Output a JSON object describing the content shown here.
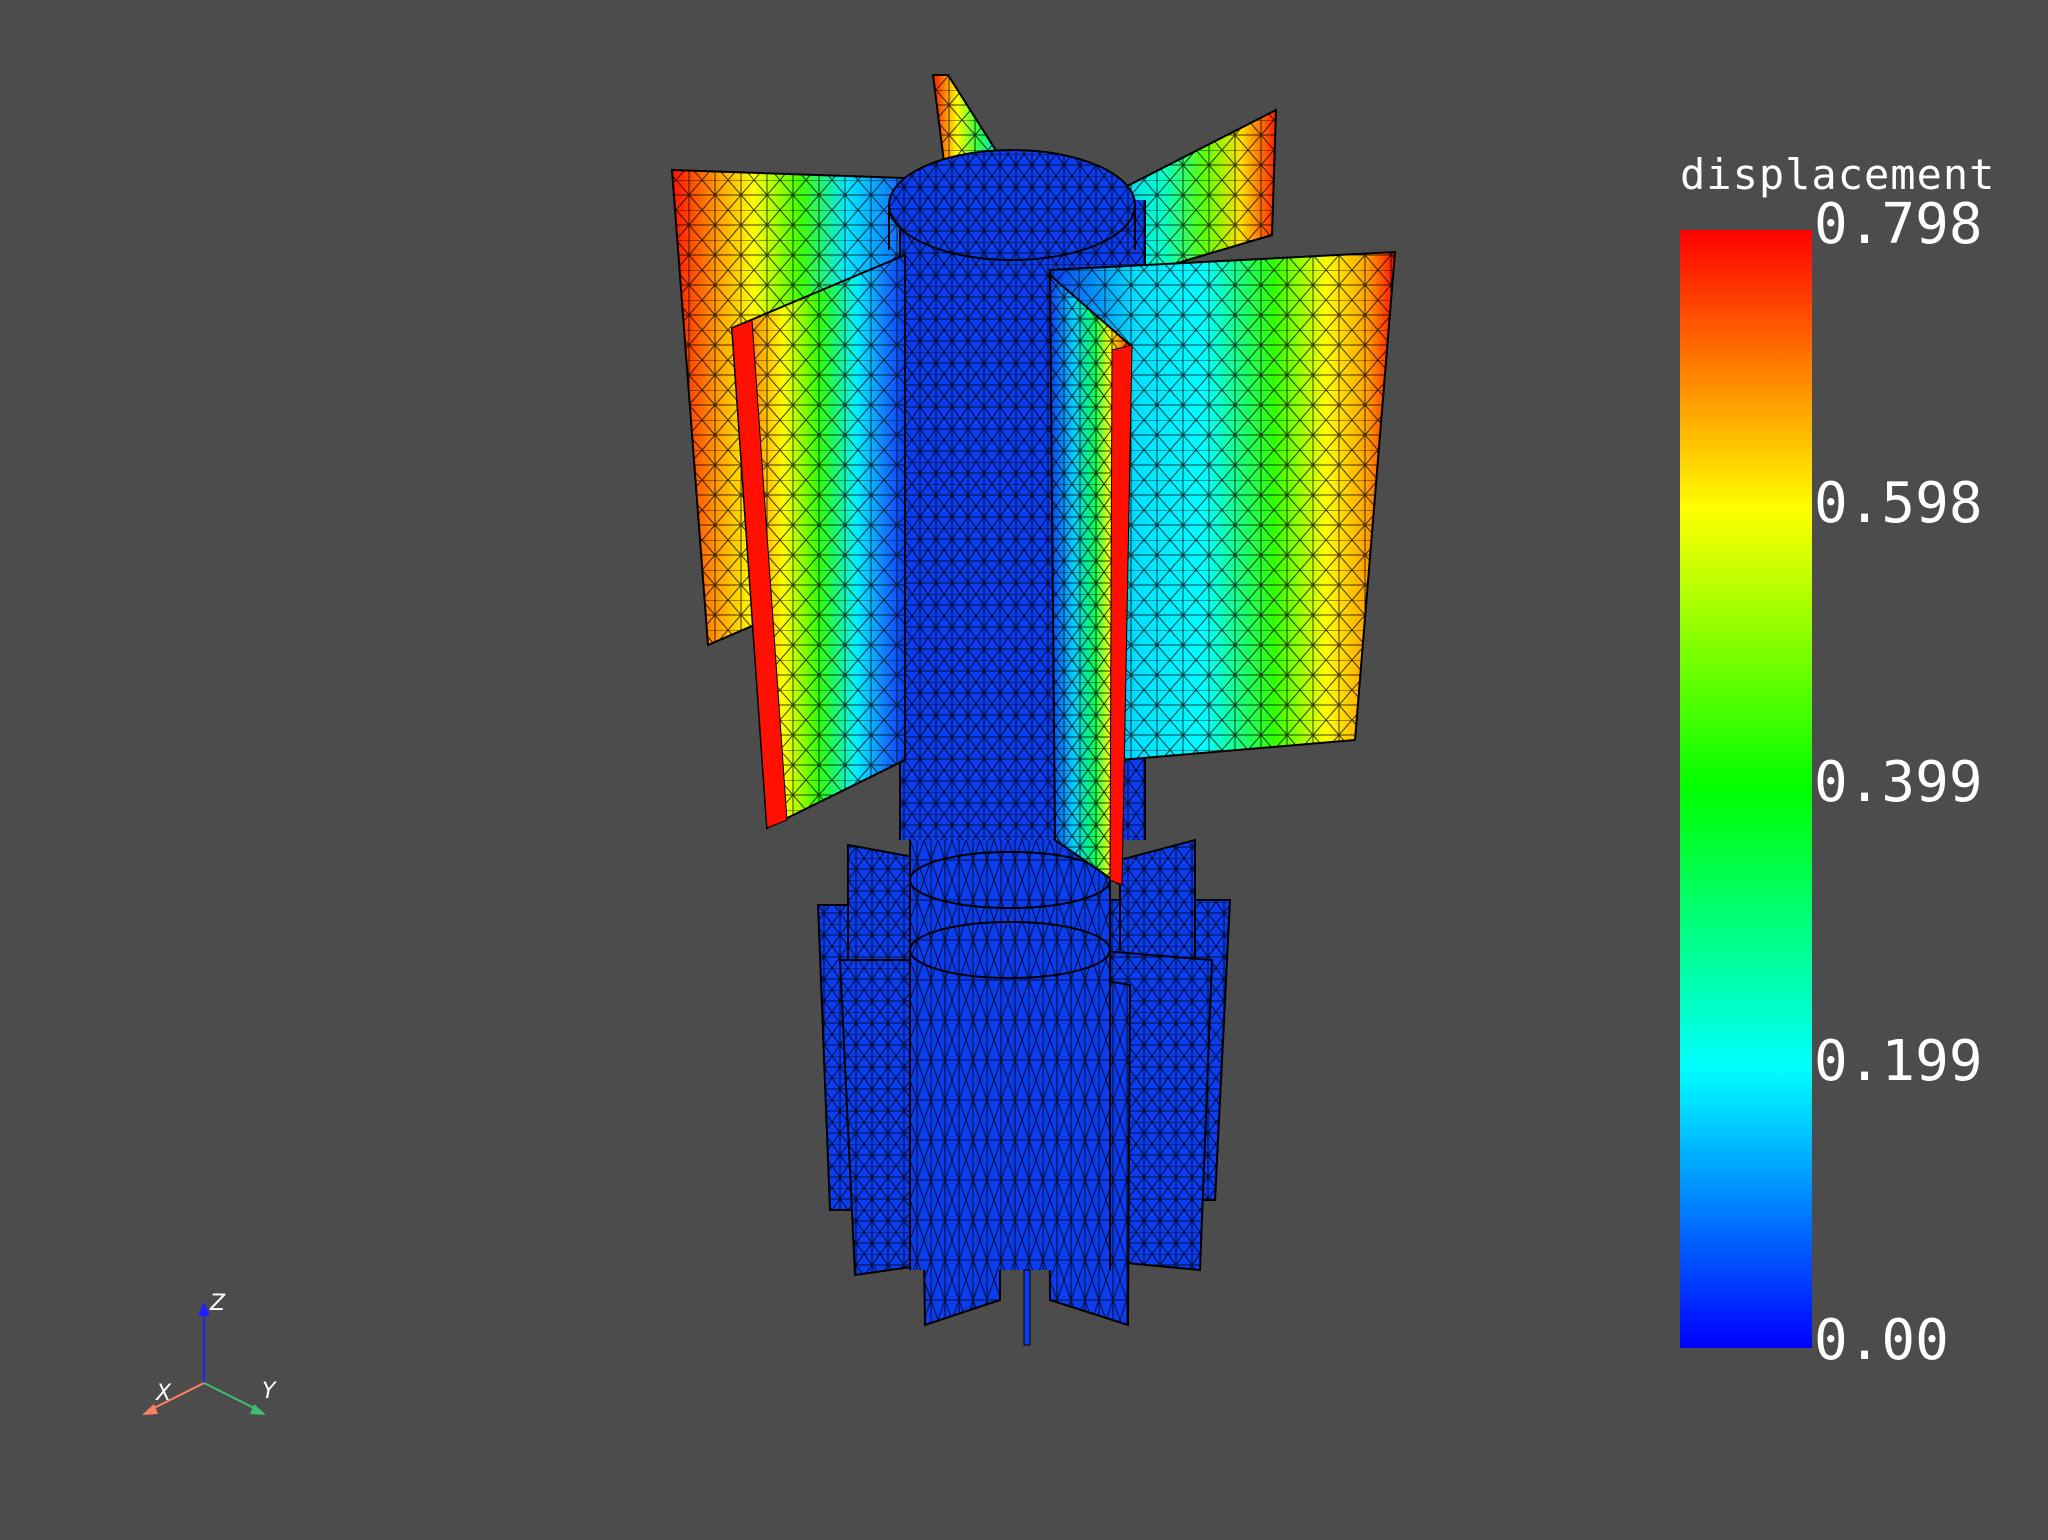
{
  "colorbar": {
    "title": "displacement",
    "ticks": [
      "0.798",
      "0.598",
      "0.399",
      "0.199",
      "0.00"
    ],
    "min": 0.0,
    "max": 0.798,
    "colormap": [
      "#0000ff",
      "#00ffff",
      "#00ff00",
      "#ffff00",
      "#ff0000"
    ]
  },
  "axes": {
    "x_label": "X",
    "y_label": "Y",
    "z_label": "Z",
    "x_color": "#ff8060",
    "y_color": "#3cc070",
    "z_color": "#2020ff"
  },
  "scene": {
    "background": "#4c4c4c",
    "edge_color": "#000000",
    "base_color": "#0a3cf0"
  }
}
